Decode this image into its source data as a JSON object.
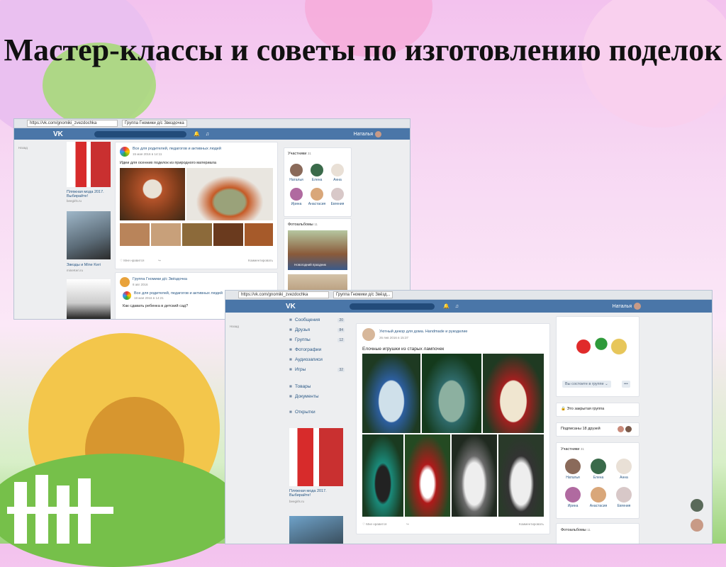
{
  "slide_title": "Мастер-классы и советы по изготовлению поделок",
  "shot1": {
    "url": "https://vk.com/gnomiki_zvezdochka",
    "tab": "Группа Гномики д/с Звездочка",
    "user": "Наталья",
    "back": "Назад",
    "ad1_title": "Пляжная мода 2017. Выбирайте!",
    "ad1_site": "beegirls.ru",
    "ad2_title": "Звезды и Mine Keri",
    "ad2_site": "mineKeri.ru",
    "post1_author": "Все для родителей, педагогов и активных людей",
    "post1_date": "15 мая 2016 в 14:11",
    "post1_text": "Идеи для осенних поделок из природного материала",
    "like": "Мне нравится",
    "comment": "Комментировать",
    "post2_author": "Группа Гномики д/с Звёздочка",
    "post2_date": "8 авг 2016",
    "post3_author": "Все для родителей, педагогов и активных людей",
    "post3_date": "18 мая 2016 в 14:21",
    "post3_text": "Как сдавать ребенка в детский сад?",
    "members_label": "Участники",
    "members_count": "31",
    "members": [
      "Наталья",
      "Елена",
      "Анна",
      "Ирина",
      "Анастасия",
      "Евгения"
    ],
    "albums_label": "Фотоальбомы",
    "albums_count": "11",
    "album_caption": "Новогодний праздник"
  },
  "shot2": {
    "url": "https://vk.com/gnomiki_zvezdochka",
    "tab": "Группа Гномики д/с Звёзд...",
    "user": "Наталья",
    "back": "Назад",
    "nav": [
      {
        "label": "Сообщения",
        "count": "20"
      },
      {
        "label": "Друзья",
        "count": "84"
      },
      {
        "label": "Группы",
        "count": "12"
      },
      {
        "label": "Фотографии",
        "count": ""
      },
      {
        "label": "Аудиозаписи",
        "count": ""
      },
      {
        "label": "Игры",
        "count": "32"
      }
    ],
    "nav2": [
      "Товары",
      "Документы"
    ],
    "nav3": "Открытки",
    "ad_title": "Пляжная мода 2017. Выбирайте!",
    "ad_site": "beegirls.ru",
    "post_author": "Уютный декор для дома. Handmade и рукоделие",
    "post_date": "26 янв 2016 в 15:37",
    "post_text": "Елочные игрушки из старых лампочек",
    "like": "Мне нравится",
    "comment": "Комментировать",
    "subscribe_btn": "Вы состоите в группе",
    "more_btn": "•••",
    "closed_group": "Это закрытая группа",
    "friends_sub": "Подписаны 18 друзей",
    "members_label": "Участники",
    "members_count": "31",
    "members": [
      "Наталья",
      "Елена",
      "Анна",
      "Ирина",
      "Анастасия",
      "Евгения"
    ],
    "albums_label": "Фотоальбомы",
    "albums_count": "11"
  },
  "colors": {
    "vk_blue": "#4a76a8",
    "link": "#2a5885"
  }
}
